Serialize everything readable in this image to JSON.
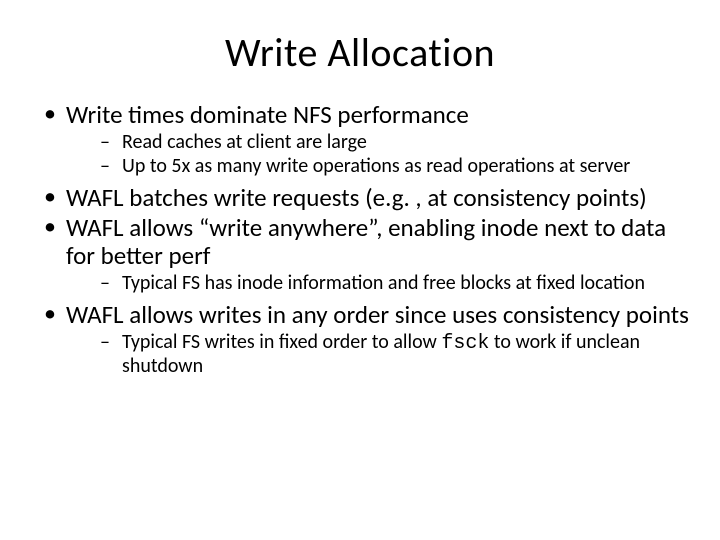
{
  "title": "Write Allocation",
  "bullets": {
    "b1": "Write times dominate NFS performance",
    "b1_1": "Read caches at client are large",
    "b1_2": "Up to 5x as many write operations as read operations at server",
    "b2": "WAFL batches write requests (e.g. , at consistency points)",
    "b3": "WAFL allows “write anywhere”, enabling inode next to data for better perf",
    "b3_1": "Typical FS has inode information and free blocks at fixed location",
    "b4": "WAFL allows writes in any order since uses consistency points",
    "b4_1a": "Typical FS writes in fixed order to allow ",
    "b4_1_code": "fsck",
    "b4_1b": " to work if unclean shutdown"
  }
}
